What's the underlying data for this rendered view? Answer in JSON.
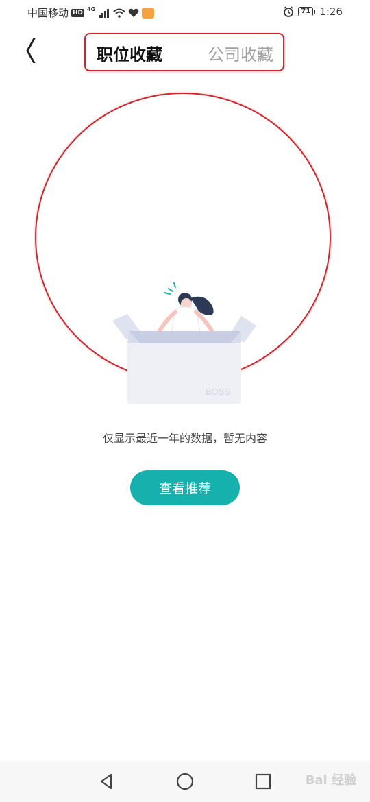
{
  "status_bar": {
    "carrier": "中国移动",
    "hd_badge": "HD",
    "network_badge": "4G",
    "battery_level": "71",
    "time": "1:26",
    "icons": [
      "signal-icon",
      "wifi-icon",
      "heart-icon",
      "app-notification-icon",
      "alarm-icon",
      "battery-icon"
    ]
  },
  "header": {
    "back_icon": "chevron-left-icon",
    "tabs": [
      {
        "label": "职位收藏",
        "active": true
      },
      {
        "label": "公司收藏",
        "active": false
      }
    ]
  },
  "empty_state": {
    "illustration": "person-in-box-illustration",
    "box_label": "BOSS",
    "message": "仅显示最近一年的数据，暂无内容"
  },
  "actions": {
    "recommend_label": "查看推荐"
  },
  "nav_bar": {
    "icons": [
      "back-triangle-icon",
      "home-circle-icon",
      "recents-square-icon"
    ],
    "watermark": "Bai 经验"
  },
  "colors": {
    "accent": "#16b1ad",
    "annotation": "#d0252c",
    "tab_inactive": "#a0a0a0"
  }
}
